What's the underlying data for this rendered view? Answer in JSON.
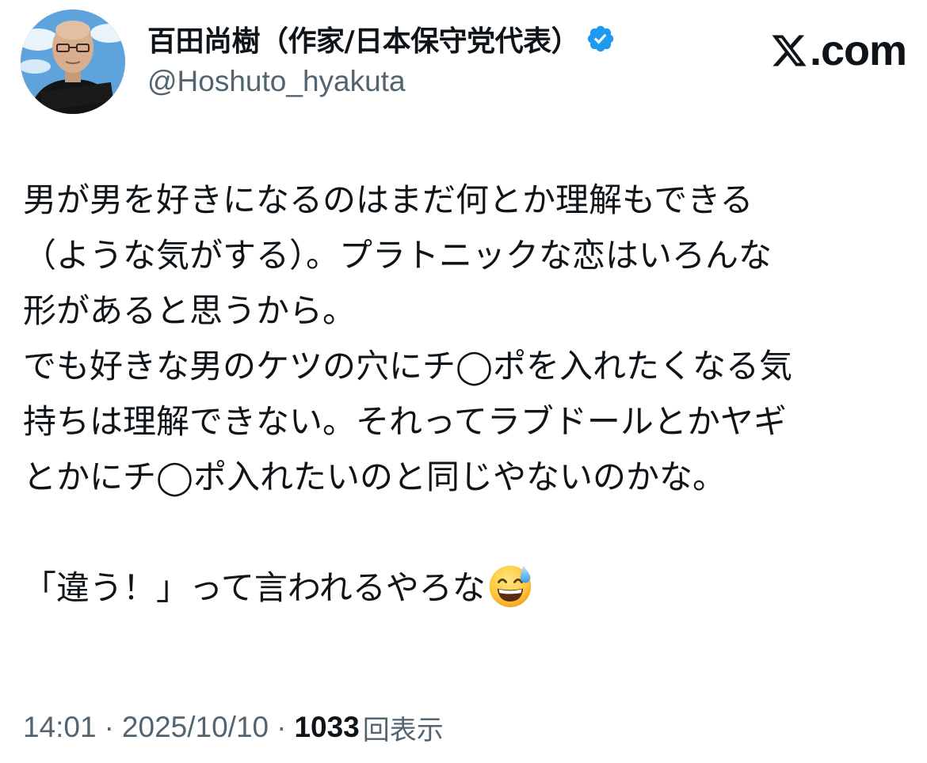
{
  "author": {
    "display_name": "百田尚樹（作家/日本保守党代表）",
    "handle": "@Hoshuto_hyakuta",
    "avatar_caption": "百田尚樹",
    "verified": true,
    "verified_color": "#1d9bf0"
  },
  "source": {
    "logo_icon": "x-logo-icon",
    "domain_suffix": ".com"
  },
  "tweet": {
    "lines": [
      "男が男を好きになるのはまだ何とか理解もできる",
      "（ような気がする）。プラトニックな恋はいろんな",
      "形があると思うから。",
      "でも好きな男のケツの穴にチ◯ポを入れたくなる気",
      "持ちは理解できない。それってラブドールとかヤギ",
      "とかにチ◯ポ入れたいのと同じやないのかな。"
    ],
    "last_line": "「違う！」って言われるやろな",
    "last_emoji": "grinning-face-with-sweat-emoji"
  },
  "meta": {
    "time": "14:01",
    "date": "2025/10/10",
    "separator": "·",
    "views_count": "1033",
    "views_label": "回表示"
  },
  "colors": {
    "text_primary": "#0f1419",
    "text_secondary": "#536471",
    "background": "#ffffff"
  }
}
